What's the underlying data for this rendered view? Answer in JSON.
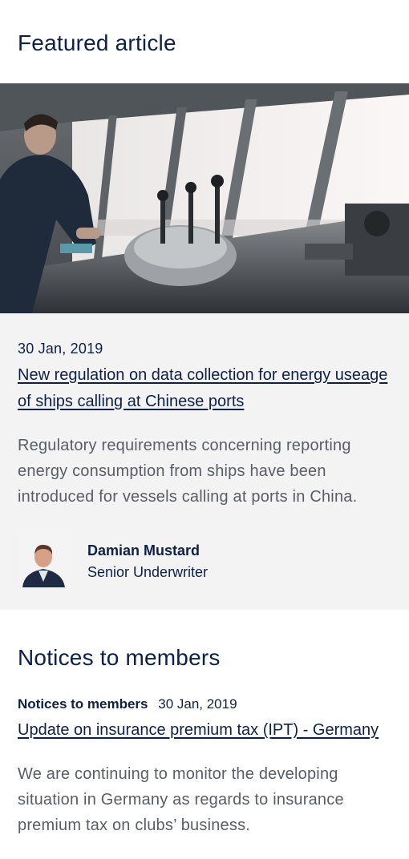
{
  "featured": {
    "title": "Featured article",
    "date": "30 Jan, 2019",
    "headline": "New regulation on data collection for energy useage of ships calling at Chinese ports",
    "excerpt": "Regulatory requirements concerning reporting energy consumption from ships have been introduced for vessels calling at ports in China.",
    "author": {
      "name": "Damian Mustard",
      "role": "Senior Underwriter"
    }
  },
  "notices": {
    "title": "Notices to members",
    "item": {
      "category": "Notices to members",
      "date": "30 Jan, 2019",
      "headline": "Update on insurance premium tax (IPT) - Germany",
      "excerpt": "We are continuing to monitor the developing situation in Germany as regards to insurance premium tax on clubs’ business."
    }
  }
}
